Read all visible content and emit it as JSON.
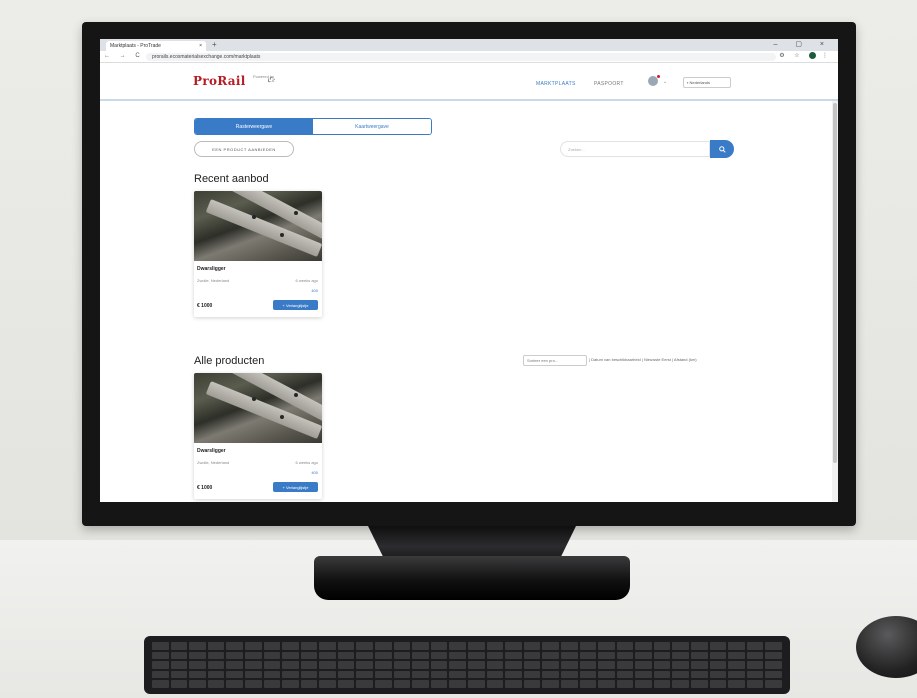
{
  "browser": {
    "tab_title": "Marktplaats - ProTrade",
    "tab_close": "×",
    "new_tab": "+",
    "window_controls": "–  ▢  ×",
    "nav_buttons": "← → C",
    "url": "prorails.ecosmaterialsexchange.com/marktplaats"
  },
  "header": {
    "logo": "ProRail",
    "logo_sub": "Powered by",
    "nav_marktplaats": "MARKTPLAATS",
    "nav_paspoort": "PASPOORT",
    "avatar_caret": "⌄",
    "language": "Nederlands"
  },
  "toolbar": {
    "toggle_tiles": "Rasterweergave",
    "toggle_map": "Kaartweergave",
    "add_product": "EEN PRODUCT AANBIEDEN",
    "search_placeholder": "Zoeken..."
  },
  "sections": {
    "recent": "Recent aanbod",
    "all": "Alle producten"
  },
  "sort": {
    "placeholder": "Sorteer een pro...",
    "options": "| Datum van beschikbaarheid | Nieuwste Eerst | Afstand (km)"
  },
  "cards": [
    {
      "name": "Dwarsligger",
      "location": "Zwolle, Nederland",
      "time": "6 weeks ago",
      "quantity": "400",
      "price": "€ 1000",
      "button": "+ Verlanglijstje"
    },
    {
      "name": "Dwarsligger",
      "location": "Zwolle, Nederland",
      "time": "6 weeks ago",
      "quantity": "400",
      "price": "€ 1000",
      "button": "+ Verlanglijstje"
    }
  ],
  "colors": {
    "brand_red": "#b51c24",
    "accent_blue": "#3a7bc8"
  }
}
